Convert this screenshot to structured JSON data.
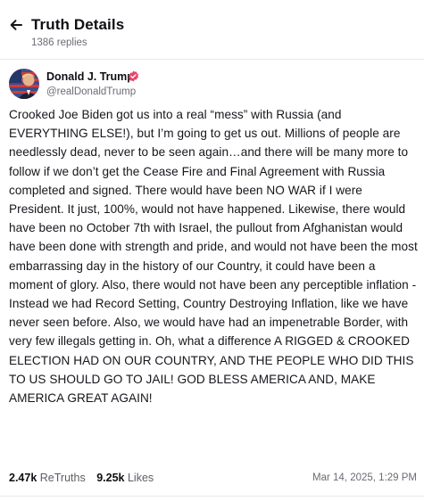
{
  "header": {
    "title": "Truth Details",
    "subtitle": "1386 replies"
  },
  "author": {
    "name": "Donald J. Trump",
    "handle": "@realDonaldTrump",
    "verified_color": "#e8436c"
  },
  "post": {
    "text": "Crooked Joe Biden got us into a real “mess” with Russia (and EVERYTHING ELSE!), but I’m going to get us out. Millions of people are needlessly dead, never to be seen again…and there will be many more to follow if we don’t get the Cease Fire and Final Agreement with Russia completed and signed. There would have been NO WAR if I were President. It just, 100%, would not have happened. Likewise, there would have been no October 7th with Israel, the pullout from Afghanistan would have been done with strength and pride, and would not have been the most embarrassing day in the history of our Country, it could have been a moment of glory. Also, there would not have been any perceptible inflation - Instead we had Record Setting, Country Destroying Inflation, like we have never seen before. Also, we would have had an impenetrable Border, with very few illegals getting in. Oh, what a difference A RIGGED & CROOKED ELECTION HAD ON OUR COUNTRY, AND THE PEOPLE WHO DID THIS TO US SHOULD GO TO JAIL! GOD BLESS AMERICA AND, MAKE AMERICA GREAT AGAIN!",
    "retruths_count": "2.47k",
    "retruths_label": "ReTruths",
    "likes_count": "9.25k",
    "likes_label": "Likes",
    "date": "Mar 14, 2025, 1:29 PM"
  }
}
